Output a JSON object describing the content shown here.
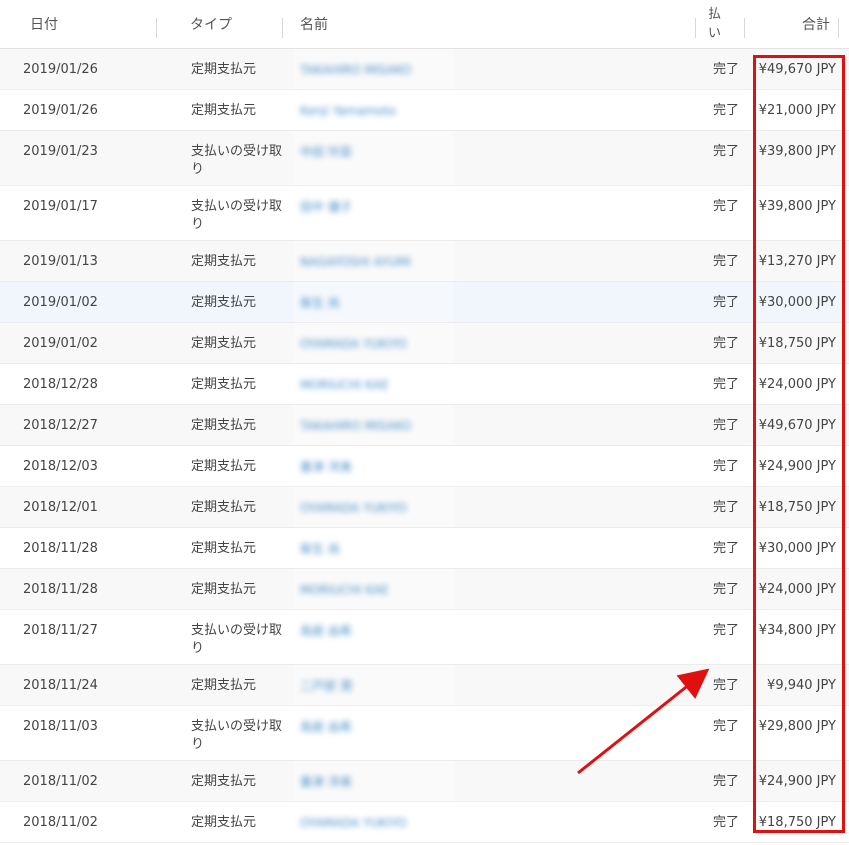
{
  "header": {
    "date": "日付",
    "type": "タイプ",
    "name": "名前",
    "payment_line1": "払",
    "payment_line2": "い",
    "total": "合計"
  },
  "rows": [
    {
      "date": "2019/01/26",
      "type": "定期支払元",
      "type2": "",
      "name": "TAKAHIRO MISAKO",
      "status": "完了",
      "total": "¥49,670 JPY",
      "tall": false
    },
    {
      "date": "2019/01/26",
      "type": "定期支払元",
      "type2": "",
      "name": "Kenji Yamamoto",
      "status": "完了",
      "total": "¥21,000 JPY",
      "tall": false
    },
    {
      "date": "2019/01/23",
      "type": "支払いの受け取",
      "type2": "り",
      "name": "中田 玲菜",
      "status": "完了",
      "total": "¥39,800 JPY",
      "tall": true
    },
    {
      "date": "2019/01/17",
      "type": "支払いの受け取",
      "type2": "り",
      "name": "田中 優子",
      "status": "完了",
      "total": "¥39,800 JPY",
      "tall": true
    },
    {
      "date": "2019/01/13",
      "type": "定期支払元",
      "type2": "",
      "name": "NAGAYOSHI AYUMI",
      "status": "完了",
      "total": "¥13,270 JPY",
      "tall": false
    },
    {
      "date": "2019/01/02",
      "type": "定期支払元",
      "type2": "",
      "name": "柴生 尚",
      "status": "完了",
      "total": "¥30,000 JPY",
      "tall": false
    },
    {
      "date": "2019/01/02",
      "type": "定期支払元",
      "type2": "",
      "name": "OYAMADA YUKIYO",
      "status": "完了",
      "total": "¥18,750 JPY",
      "tall": false
    },
    {
      "date": "2018/12/28",
      "type": "定期支払元",
      "type2": "",
      "name": "MORIUCHI KAE",
      "status": "完了",
      "total": "¥24,000 JPY",
      "tall": false
    },
    {
      "date": "2018/12/27",
      "type": "定期支払元",
      "type2": "",
      "name": "TAKAHIRO MISAKO",
      "status": "完了",
      "total": "¥49,670 JPY",
      "tall": false
    },
    {
      "date": "2018/12/03",
      "type": "定期支払元",
      "type2": "",
      "name": "重津 洋美",
      "status": "完了",
      "total": "¥24,900 JPY",
      "tall": false
    },
    {
      "date": "2018/12/01",
      "type": "定期支払元",
      "type2": "",
      "name": "OYAMADA YUKIYO",
      "status": "完了",
      "total": "¥18,750 JPY",
      "tall": false
    },
    {
      "date": "2018/11/28",
      "type": "定期支払元",
      "type2": "",
      "name": "柴生 尚",
      "status": "完了",
      "total": "¥30,000 JPY",
      "tall": false
    },
    {
      "date": "2018/11/28",
      "type": "定期支払元",
      "type2": "",
      "name": "MORIUCHI KAE",
      "status": "完了",
      "total": "¥24,000 JPY",
      "tall": false
    },
    {
      "date": "2018/11/27",
      "type": "支払いの受け取",
      "type2": "り",
      "name": "鳥居 由希",
      "status": "完了",
      "total": "¥34,800 JPY",
      "tall": true
    },
    {
      "date": "2018/11/24",
      "type": "定期支払元",
      "type2": "",
      "name": "二戸部 潤",
      "status": "完了",
      "total": "¥9,940 JPY",
      "tall": false
    },
    {
      "date": "2018/11/03",
      "type": "支払いの受け取",
      "type2": "り",
      "name": "鳥居 由希",
      "status": "完了",
      "total": "¥29,800 JPY",
      "tall": true
    },
    {
      "date": "2018/11/02",
      "type": "定期支払元",
      "type2": "",
      "name": "重津 洋美",
      "status": "完了",
      "total": "¥24,900 JPY",
      "tall": false
    },
    {
      "date": "2018/11/02",
      "type": "定期支払元",
      "type2": "",
      "name": "OYAMADA YUKIYO",
      "status": "完了",
      "total": "¥18,750 JPY",
      "tall": false
    }
  ],
  "annotation": {
    "color": "#e01010"
  }
}
